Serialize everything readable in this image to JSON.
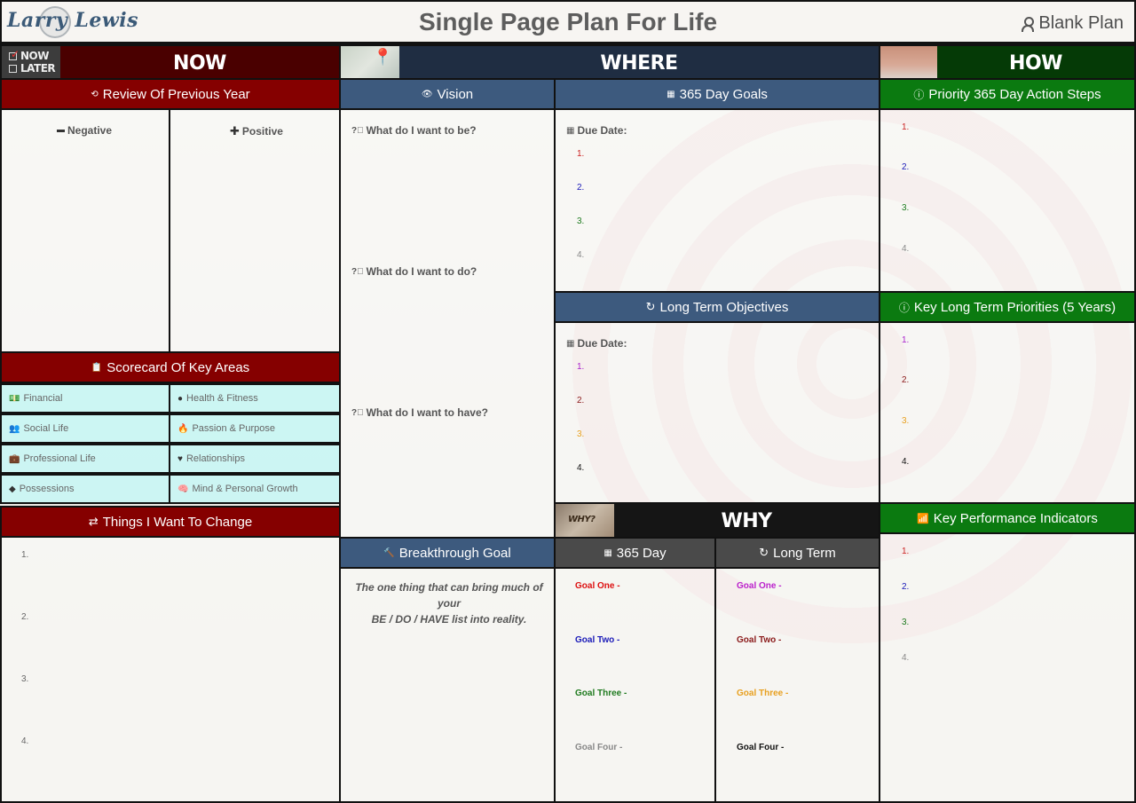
{
  "header": {
    "logo_text": "Larry Lewis",
    "title": "Single Page Plan For Life",
    "plan_name": "Blank Plan",
    "plan_icon": "person-icon"
  },
  "sections": {
    "now": {
      "title": "NOW",
      "toggle": {
        "now_label": "NOW",
        "later_label": "LATER",
        "now_checked": true,
        "later_checked": false
      }
    },
    "where": {
      "title": "WHERE"
    },
    "how": {
      "title": "HOW"
    },
    "why": {
      "title": "WHY"
    }
  },
  "review": {
    "title": "Review Of Previous Year",
    "icon": "history-icon",
    "negative_label": "Negative",
    "positive_label": "Positive"
  },
  "scorecard": {
    "title": "Scorecard Of Key Areas",
    "icon": "clipboard-icon",
    "areas": [
      {
        "label": "Financial",
        "icon": "money-icon"
      },
      {
        "label": "Health & Fitness",
        "icon": "apple-icon"
      },
      {
        "label": "Social Life",
        "icon": "users-icon"
      },
      {
        "label": "Passion & Purpose",
        "icon": "fire-icon"
      },
      {
        "label": "Professional Life",
        "icon": "briefcase-icon"
      },
      {
        "label": "Relationships",
        "icon": "heart-icon"
      },
      {
        "label": "Possessions",
        "icon": "diamond-icon"
      },
      {
        "label": "Mind & Personal Growth",
        "icon": "brain-icon"
      }
    ]
  },
  "change": {
    "title": "Things I Want To Change",
    "icon": "exchange-icon",
    "items": [
      "1.",
      "2.",
      "3.",
      "4."
    ]
  },
  "vision": {
    "title": "Vision",
    "icon": "eye-icon",
    "questions": [
      "What do I want to be?",
      "What do I want to do?",
      "What do I want to have?"
    ]
  },
  "breakthrough": {
    "title": "Breakthrough Goal",
    "icon": "gavel-icon",
    "note_line1": "The one thing that can bring much of your",
    "note_line2": "BE / DO / HAVE list into reality."
  },
  "goals_365": {
    "title": "365 Day Goals",
    "icon": "calendar-icon",
    "due_label": "Due Date:",
    "items": [
      {
        "label": "1.",
        "color": "#cc2222"
      },
      {
        "label": "2.",
        "color": "#1a1ab8"
      },
      {
        "label": "3.",
        "color": "#1e7a1e"
      },
      {
        "label": "4.",
        "color": "#888888"
      }
    ]
  },
  "long_term": {
    "title": "Long Term Objectives",
    "icon": "refresh-icon",
    "due_label": "Due Date:",
    "items": [
      {
        "label": "1.",
        "color": "#aa22cc"
      },
      {
        "label": "2.",
        "color": "#8a1a1a"
      },
      {
        "label": "3.",
        "color": "#e8a020"
      },
      {
        "label": "4.",
        "color": "#111111"
      }
    ]
  },
  "why": {
    "col1_title": "365 Day",
    "col1_icon": "calendar-icon",
    "col2_title": "Long Term",
    "col2_icon": "refresh-icon",
    "col1_goals": [
      {
        "label": "Goal One -",
        "color": "#dd1111"
      },
      {
        "label": "Goal Two -",
        "color": "#1a1ab8"
      },
      {
        "label": "Goal Three -",
        "color": "#1e7a1e"
      },
      {
        "label": "Goal Four -",
        "color": "#888888"
      }
    ],
    "col2_goals": [
      {
        "label": "Goal One -",
        "color": "#bb22cc"
      },
      {
        "label": "Goal Two -",
        "color": "#8a1a1a"
      },
      {
        "label": "Goal Three -",
        "color": "#e8a020"
      },
      {
        "label": "Goal Four -",
        "color": "#111111"
      }
    ]
  },
  "priority_365": {
    "title": "Priority 365 Day Action Steps",
    "icon": "exclamation-circle-icon",
    "items": [
      {
        "label": "1.",
        "color": "#cc2222"
      },
      {
        "label": "2.",
        "color": "#1a1ab8"
      },
      {
        "label": "3.",
        "color": "#1e7a1e"
      },
      {
        "label": "4.",
        "color": "#888888"
      }
    ]
  },
  "key_long_term": {
    "title": "Key Long Term Priorities (5 Years)",
    "icon": "exclamation-circle-icon",
    "items": [
      {
        "label": "1.",
        "color": "#aa22cc"
      },
      {
        "label": "2.",
        "color": "#8a1a1a"
      },
      {
        "label": "3.",
        "color": "#e8a020"
      },
      {
        "label": "4.",
        "color": "#111111"
      }
    ]
  },
  "kpi": {
    "title": "Key Performance Indicators",
    "icon": "chart-icon",
    "items": [
      {
        "label": "1.",
        "color": "#cc2222"
      },
      {
        "label": "2.",
        "color": "#1a1ab8"
      },
      {
        "label": "3.",
        "color": "#1e7a1e"
      },
      {
        "label": "4.",
        "color": "#888888"
      }
    ]
  },
  "colors": {
    "now_dark": "#4a0000",
    "now_header": "#850000",
    "where_dark": "#1f2d42",
    "where_header": "#3d5a7e",
    "how_dark": "#053a06",
    "how_header": "#0b7a10",
    "why_dark": "#151515",
    "why_header": "#4a4a4a",
    "scorecard_cell": "#c8f6f4"
  }
}
